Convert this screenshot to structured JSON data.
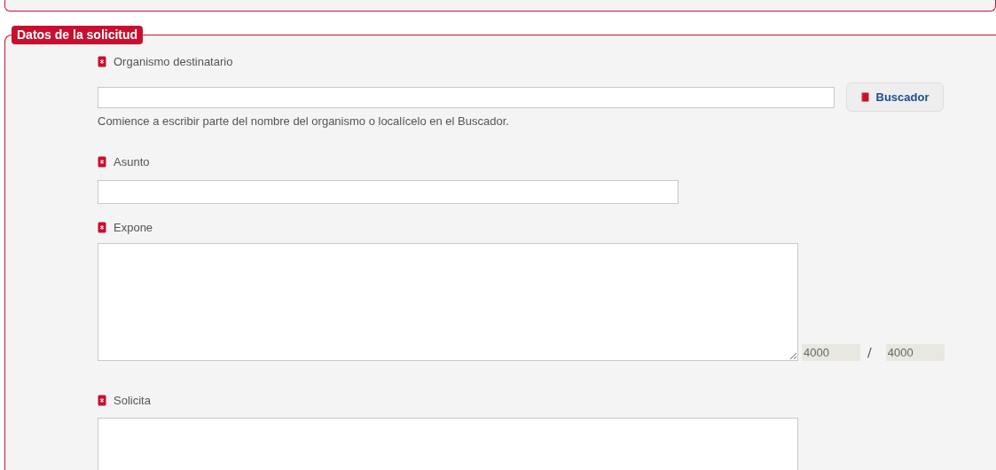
{
  "section": {
    "legend": "Datos de la solicitud"
  },
  "fields": [
    {
      "kind": "search",
      "label": "Organismo destinatario",
      "required": true,
      "button": "Buscador",
      "hint": "Comience a escribir parte del nombre del organismo o localícelo en el Buscador."
    },
    {
      "kind": "text",
      "label": "Asunto",
      "required": true
    },
    {
      "kind": "textarea",
      "label": "Expone",
      "required": true,
      "remaining": "4000",
      "max": "4000",
      "separator": "/"
    },
    {
      "kind": "textarea-cut",
      "label": "Solicita",
      "required": true
    }
  ]
}
